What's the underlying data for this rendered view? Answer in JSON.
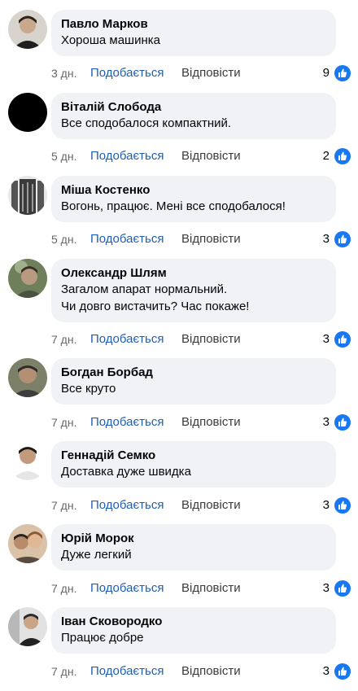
{
  "comments": [
    {
      "author": "Павло Марков",
      "text": [
        "Хороша машинка"
      ],
      "time": "3 дн.",
      "like_label": "Подобається",
      "reply_label": "Відповісти",
      "likes": "9",
      "avatar_color": "#3a2f2a"
    },
    {
      "author": "Віталій Слобода",
      "text": [
        "Все сподобалося компактний."
      ],
      "time": "5 дн.",
      "like_label": "Подобається",
      "reply_label": "Відповісти",
      "likes": "2",
      "avatar_color": "#000000"
    },
    {
      "author": "Міша Костенко",
      "text": [
        "Вогонь, працює. Мені все сподобалося!"
      ],
      "time": "5 дн.",
      "like_label": "Подобається",
      "reply_label": "Відповісти",
      "likes": "3",
      "avatar_color": "#2b2b2b"
    },
    {
      "author": "Олександр Шлям",
      "text": [
        "Загалом апарат нормальний.",
        "Чи довго вистачить? Час покаже!"
      ],
      "time": "7 дн.",
      "like_label": "Подобається",
      "reply_label": "Відповісти",
      "likes": "3",
      "avatar_color": "#5a6b4a"
    },
    {
      "author": "Богдан Борбад",
      "text": [
        "Все круто"
      ],
      "time": "7 дн.",
      "like_label": "Подобається",
      "reply_label": "Відповісти",
      "likes": "3",
      "avatar_color": "#6b6f5a"
    },
    {
      "author": "Геннадій Семко",
      "text": [
        "Доставка дуже швидка"
      ],
      "time": "7 дн.",
      "like_label": "Подобається",
      "reply_label": "Відповісти",
      "likes": "3",
      "avatar_color": "#4a3b35"
    },
    {
      "author": "Юрій Морок",
      "text": [
        "Дуже легкий"
      ],
      "time": "7 дн.",
      "like_label": "Подобається",
      "reply_label": "Відповісти",
      "likes": "3",
      "avatar_color": "#8a6a55"
    },
    {
      "author": "Іван Сковородко",
      "text": [
        "Працює добре"
      ],
      "time": "7 дн.",
      "like_label": "Подобається",
      "reply_label": "Відповісти",
      "likes": "3",
      "avatar_color": "#9a9a9a"
    }
  ],
  "like_icon_color": "#1877f2"
}
